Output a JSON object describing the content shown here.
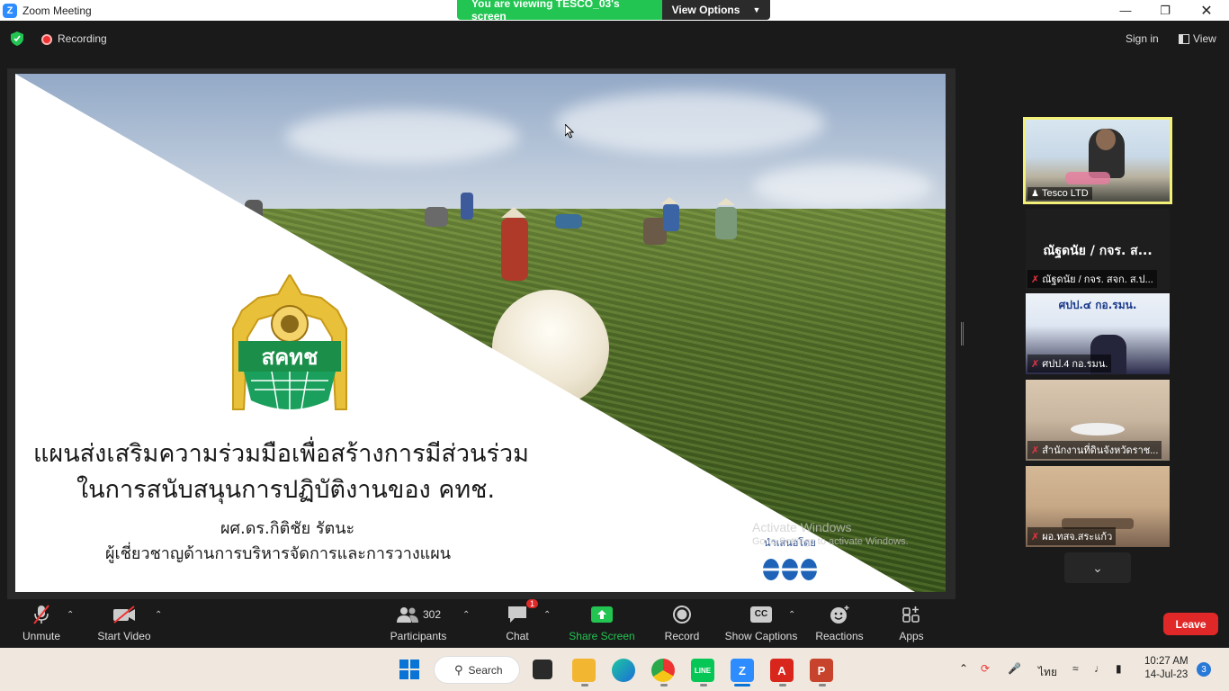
{
  "window": {
    "title": "Zoom Meeting"
  },
  "banner": {
    "viewing_text": "You are viewing TESCO_03's screen",
    "view_options": "View Options"
  },
  "status": {
    "recording": "Recording",
    "sign_in": "Sign in",
    "view": "View"
  },
  "slide": {
    "title_line1": "แผนส่งเสริมความร่วมมือเพื่อสร้างการมีส่วนร่วม",
    "title_line2": "ในการสนับสนุนการปฏิบัติงานของ คทช.",
    "author": "ผศ.ดร.กิติชัย รัตนะ",
    "role": "ผู้เชี่ยวชาญด้านการบริหารจัดการและการวางแผน",
    "logo_text": "สคทช",
    "presenter_label": "นำเสนอโดย"
  },
  "watermark": {
    "line1": "Activate Windows",
    "line2": "Go to Settings to activate Windows."
  },
  "participants_videos": [
    {
      "name": "Tesco LTD",
      "muted": false,
      "active": true
    },
    {
      "name": "ณัฐดนัย / กจร. สจก. ส.ป...",
      "big_name": "ณัฐดนัย / กจร. ส...",
      "muted": true,
      "active": false
    },
    {
      "name": "ศปป.4 กอ.รมน.",
      "caption": "ศปป.๔ กอ.รมน.",
      "muted": true,
      "active": false
    },
    {
      "name": "สำนักงานที่ดินจังหวัดราช...",
      "muted": true,
      "active": false
    },
    {
      "name": "ผอ.ทสจ.สระแก้ว",
      "muted": true,
      "active": false
    }
  ],
  "toolbar": {
    "unmute": "Unmute",
    "start_video": "Start Video",
    "participants": "Participants",
    "participants_count": "302",
    "chat": "Chat",
    "chat_badge": "1",
    "share_screen": "Share Screen",
    "record": "Record",
    "show_captions": "Show Captions",
    "captions_glyph": "CC",
    "reactions": "Reactions",
    "apps": "Apps",
    "leave": "Leave"
  },
  "taskbar": {
    "search": "Search",
    "language": "ไทย",
    "time": "10:27 AM",
    "date": "14-Jul-23",
    "notifications": "3"
  },
  "colors": {
    "accent_green": "#23c552",
    "leave_red": "#e02828",
    "active_border": "#f3f07a",
    "zoom_blue": "#2d8cff"
  }
}
